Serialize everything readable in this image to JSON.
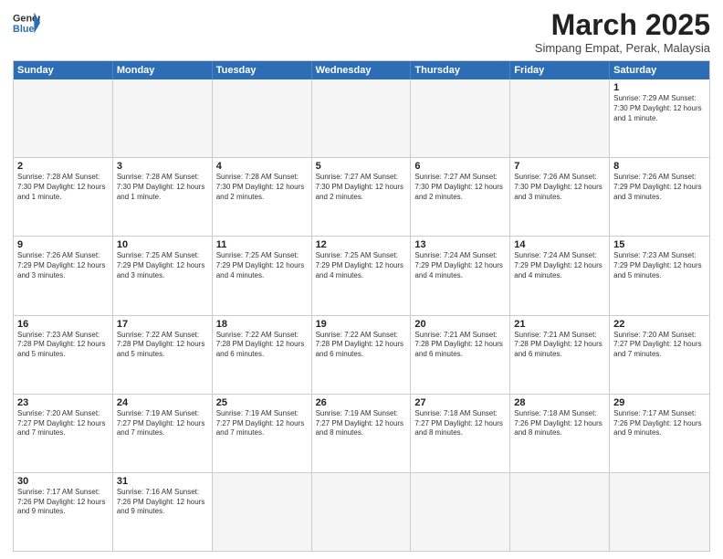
{
  "header": {
    "logo_general": "General",
    "logo_blue": "Blue",
    "month_title": "March 2025",
    "subtitle": "Simpang Empat, Perak, Malaysia"
  },
  "weekdays": [
    "Sunday",
    "Monday",
    "Tuesday",
    "Wednesday",
    "Thursday",
    "Friday",
    "Saturday"
  ],
  "rows": [
    [
      {
        "day": "",
        "text": "",
        "empty": true
      },
      {
        "day": "",
        "text": "",
        "empty": true
      },
      {
        "day": "",
        "text": "",
        "empty": true
      },
      {
        "day": "",
        "text": "",
        "empty": true
      },
      {
        "day": "",
        "text": "",
        "empty": true
      },
      {
        "day": "",
        "text": "",
        "empty": true
      },
      {
        "day": "1",
        "text": "Sunrise: 7:29 AM\nSunset: 7:30 PM\nDaylight: 12 hours and 1 minute.",
        "empty": false
      }
    ],
    [
      {
        "day": "2",
        "text": "Sunrise: 7:28 AM\nSunset: 7:30 PM\nDaylight: 12 hours and 1 minute.",
        "empty": false
      },
      {
        "day": "3",
        "text": "Sunrise: 7:28 AM\nSunset: 7:30 PM\nDaylight: 12 hours and 1 minute.",
        "empty": false
      },
      {
        "day": "4",
        "text": "Sunrise: 7:28 AM\nSunset: 7:30 PM\nDaylight: 12 hours and 2 minutes.",
        "empty": false
      },
      {
        "day": "5",
        "text": "Sunrise: 7:27 AM\nSunset: 7:30 PM\nDaylight: 12 hours and 2 minutes.",
        "empty": false
      },
      {
        "day": "6",
        "text": "Sunrise: 7:27 AM\nSunset: 7:30 PM\nDaylight: 12 hours and 2 minutes.",
        "empty": false
      },
      {
        "day": "7",
        "text": "Sunrise: 7:26 AM\nSunset: 7:30 PM\nDaylight: 12 hours and 3 minutes.",
        "empty": false
      },
      {
        "day": "8",
        "text": "Sunrise: 7:26 AM\nSunset: 7:29 PM\nDaylight: 12 hours and 3 minutes.",
        "empty": false
      }
    ],
    [
      {
        "day": "9",
        "text": "Sunrise: 7:26 AM\nSunset: 7:29 PM\nDaylight: 12 hours and 3 minutes.",
        "empty": false
      },
      {
        "day": "10",
        "text": "Sunrise: 7:25 AM\nSunset: 7:29 PM\nDaylight: 12 hours and 3 minutes.",
        "empty": false
      },
      {
        "day": "11",
        "text": "Sunrise: 7:25 AM\nSunset: 7:29 PM\nDaylight: 12 hours and 4 minutes.",
        "empty": false
      },
      {
        "day": "12",
        "text": "Sunrise: 7:25 AM\nSunset: 7:29 PM\nDaylight: 12 hours and 4 minutes.",
        "empty": false
      },
      {
        "day": "13",
        "text": "Sunrise: 7:24 AM\nSunset: 7:29 PM\nDaylight: 12 hours and 4 minutes.",
        "empty": false
      },
      {
        "day": "14",
        "text": "Sunrise: 7:24 AM\nSunset: 7:29 PM\nDaylight: 12 hours and 4 minutes.",
        "empty": false
      },
      {
        "day": "15",
        "text": "Sunrise: 7:23 AM\nSunset: 7:29 PM\nDaylight: 12 hours and 5 minutes.",
        "empty": false
      }
    ],
    [
      {
        "day": "16",
        "text": "Sunrise: 7:23 AM\nSunset: 7:28 PM\nDaylight: 12 hours and 5 minutes.",
        "empty": false
      },
      {
        "day": "17",
        "text": "Sunrise: 7:22 AM\nSunset: 7:28 PM\nDaylight: 12 hours and 5 minutes.",
        "empty": false
      },
      {
        "day": "18",
        "text": "Sunrise: 7:22 AM\nSunset: 7:28 PM\nDaylight: 12 hours and 6 minutes.",
        "empty": false
      },
      {
        "day": "19",
        "text": "Sunrise: 7:22 AM\nSunset: 7:28 PM\nDaylight: 12 hours and 6 minutes.",
        "empty": false
      },
      {
        "day": "20",
        "text": "Sunrise: 7:21 AM\nSunset: 7:28 PM\nDaylight: 12 hours and 6 minutes.",
        "empty": false
      },
      {
        "day": "21",
        "text": "Sunrise: 7:21 AM\nSunset: 7:28 PM\nDaylight: 12 hours and 6 minutes.",
        "empty": false
      },
      {
        "day": "22",
        "text": "Sunrise: 7:20 AM\nSunset: 7:27 PM\nDaylight: 12 hours and 7 minutes.",
        "empty": false
      }
    ],
    [
      {
        "day": "23",
        "text": "Sunrise: 7:20 AM\nSunset: 7:27 PM\nDaylight: 12 hours and 7 minutes.",
        "empty": false
      },
      {
        "day": "24",
        "text": "Sunrise: 7:19 AM\nSunset: 7:27 PM\nDaylight: 12 hours and 7 minutes.",
        "empty": false
      },
      {
        "day": "25",
        "text": "Sunrise: 7:19 AM\nSunset: 7:27 PM\nDaylight: 12 hours and 7 minutes.",
        "empty": false
      },
      {
        "day": "26",
        "text": "Sunrise: 7:19 AM\nSunset: 7:27 PM\nDaylight: 12 hours and 8 minutes.",
        "empty": false
      },
      {
        "day": "27",
        "text": "Sunrise: 7:18 AM\nSunset: 7:27 PM\nDaylight: 12 hours and 8 minutes.",
        "empty": false
      },
      {
        "day": "28",
        "text": "Sunrise: 7:18 AM\nSunset: 7:26 PM\nDaylight: 12 hours and 8 minutes.",
        "empty": false
      },
      {
        "day": "29",
        "text": "Sunrise: 7:17 AM\nSunset: 7:26 PM\nDaylight: 12 hours and 9 minutes.",
        "empty": false
      }
    ],
    [
      {
        "day": "30",
        "text": "Sunrise: 7:17 AM\nSunset: 7:26 PM\nDaylight: 12 hours and 9 minutes.",
        "empty": false
      },
      {
        "day": "31",
        "text": "Sunrise: 7:16 AM\nSunset: 7:26 PM\nDaylight: 12 hours and 9 minutes.",
        "empty": false
      },
      {
        "day": "",
        "text": "",
        "empty": true
      },
      {
        "day": "",
        "text": "",
        "empty": true
      },
      {
        "day": "",
        "text": "",
        "empty": true
      },
      {
        "day": "",
        "text": "",
        "empty": true
      },
      {
        "day": "",
        "text": "",
        "empty": true
      }
    ]
  ]
}
